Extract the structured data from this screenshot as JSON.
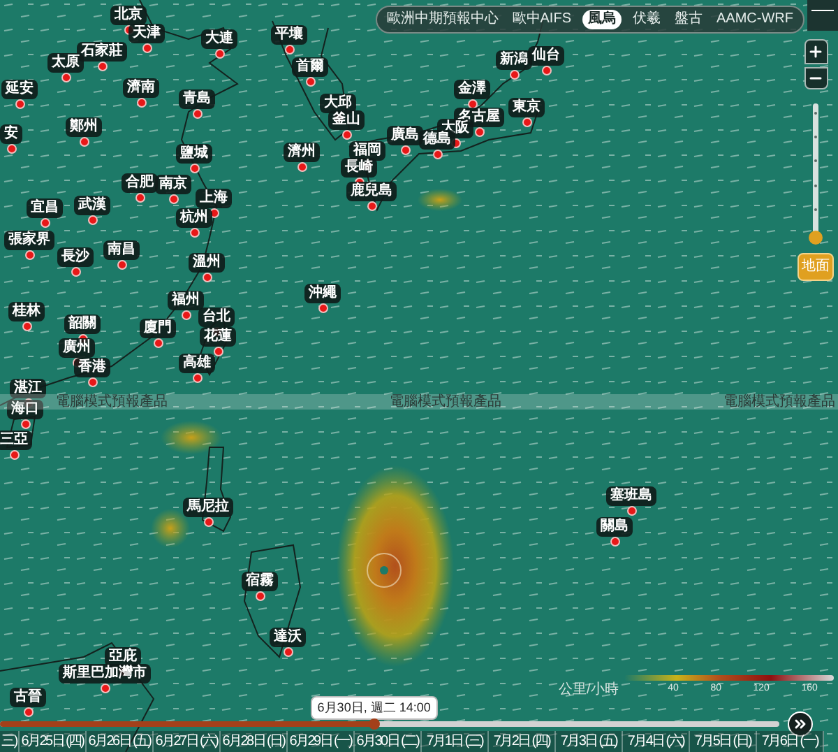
{
  "model_tabs": [
    {
      "label": "歐洲中期預報中心",
      "selected": false
    },
    {
      "label": "歐中AIFS",
      "selected": false
    },
    {
      "label": "風烏",
      "selected": true
    },
    {
      "label": "伏羲",
      "selected": false
    },
    {
      "label": "盤古",
      "selected": false
    },
    {
      "label": "AAMC-WRF",
      "selected": false
    }
  ],
  "altitude_slider": {
    "level": 0,
    "button": "地面"
  },
  "cities": [
    "北京",
    "天津",
    "石家莊",
    "太原",
    "大連",
    "平壤",
    "首爾",
    "延安",
    "濟南",
    "青島",
    "大邱",
    "釜山",
    "鄭州",
    "安",
    "鹽城",
    "濟州",
    "廣島",
    "福岡",
    "長崎",
    "鹿兒島",
    "合肥",
    "南京",
    "上海",
    "宜昌",
    "武漢",
    "杭州",
    "張家界",
    "長沙",
    "南昌",
    "溫州",
    "沖繩",
    "福州",
    "台北",
    "花蓮",
    "廈門",
    "桂林",
    "韶關",
    "廣州",
    "香港",
    "高雄",
    "湛江",
    "海口",
    "三亞",
    "新潟",
    "仙台",
    "金澤",
    "東京",
    "名古屋",
    "大阪",
    "德島",
    "馬尼拉",
    "宿霧",
    "達沃",
    "塞班島",
    "關島",
    "亞庇",
    "斯里巴加灣市",
    "古晉"
  ],
  "disclaimer_band": [
    "電腦模式預報產品",
    "電腦模式預報產品",
    "電腦模式預報產品"
  ],
  "legend": {
    "unit": "公里/小時",
    "ticks": [
      "40",
      "80",
      "120",
      "160"
    ]
  },
  "timeline": {
    "tooltip": "6月30日, 週二 14:00",
    "level": 0.48,
    "days": [
      "三)",
      "6月25日 (四)",
      "6月26日 (五)",
      "6月27日 (六)",
      "6月28日 (日)",
      "6月29日 (一)",
      "6月30日 (二)",
      "7月1日 (三)",
      "7月2日 (四)",
      "7月3日 (五)",
      "7月4日 (六)",
      "7月5日 (日)",
      "7月6日 (一)"
    ]
  }
}
